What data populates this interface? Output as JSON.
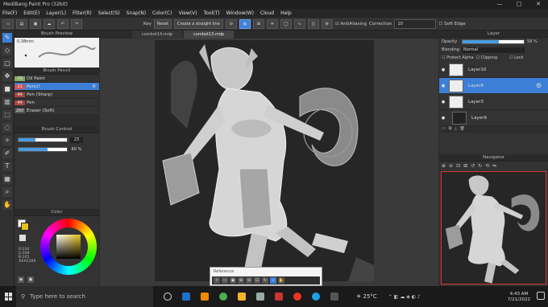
{
  "window": {
    "title": "MediBang Paint Pro (32bit)",
    "controls": [
      "—",
      "□",
      "✕"
    ]
  },
  "menu": [
    "File(F)",
    "Edit(E)",
    "Layer(L)",
    "Filter(R)",
    "Select(S)",
    "Snap(N)",
    "Color(C)",
    "View(V)",
    "Tool(T)",
    "Window(W)",
    "Cloud",
    "Help"
  ],
  "toolbar": {
    "key_label": "Key",
    "reset_label": "Reset",
    "straight_line_label": "Create a straight line",
    "antialias_label": "AntiAliasing",
    "correction_label": "Correction",
    "correction_value": "10",
    "soft_edge_label": "Soft Edge"
  },
  "tabs": [
    "combot14.mdp",
    "combot13.mdp"
  ],
  "brush_preview": {
    "title": "Brush Preview",
    "size_label": "0.38mm"
  },
  "brush_list": {
    "title": "Brush Pencil",
    "items": [
      {
        "size": "70",
        "name": "Oil Paint",
        "selected": false
      },
      {
        "size": "21",
        "name": "Pencil",
        "selected": true
      },
      {
        "size": "44",
        "name": "Pen (Sharp)",
        "selected": false
      },
      {
        "size": "44",
        "name": "Pen",
        "selected": false
      },
      {
        "size": "260",
        "name": "Eraser (Soft)",
        "selected": false
      }
    ]
  },
  "brush_control": {
    "title": "Brush Control",
    "size_value": "23",
    "opacity_value": "60 %",
    "size_fraction": 0.35,
    "opacity_fraction": 0.6
  },
  "color": {
    "title": "Color",
    "current": "#E6C21A",
    "secondary": "#FFFFFF",
    "rgb_lines": [
      "R:234",
      "G:194",
      "B:105",
      "#EAC269"
    ]
  },
  "layer_panel": {
    "title": "Layer",
    "opacity_label": "Opacity",
    "opacity_value": "59 %",
    "opacity_fraction": 0.59,
    "blending_label": "Blending",
    "blending_value": "Normal",
    "protect_alpha_label": "Protect Alpha",
    "clipping_label": "Clipping",
    "lock_label": "Lock",
    "layers": [
      {
        "name": "Layer10",
        "selected": false
      },
      {
        "name": "Layer8",
        "selected": true
      },
      {
        "name": "Layer3",
        "selected": false
      },
      {
        "name": "Layer9",
        "selected": false
      }
    ]
  },
  "navigator": {
    "title": "Navigator"
  },
  "reference": {
    "title": "Reference"
  },
  "taskbar": {
    "search_placeholder": "Type here to search",
    "temperature": "25°C",
    "time": "4:43 AM",
    "date": "7/21/2022"
  }
}
